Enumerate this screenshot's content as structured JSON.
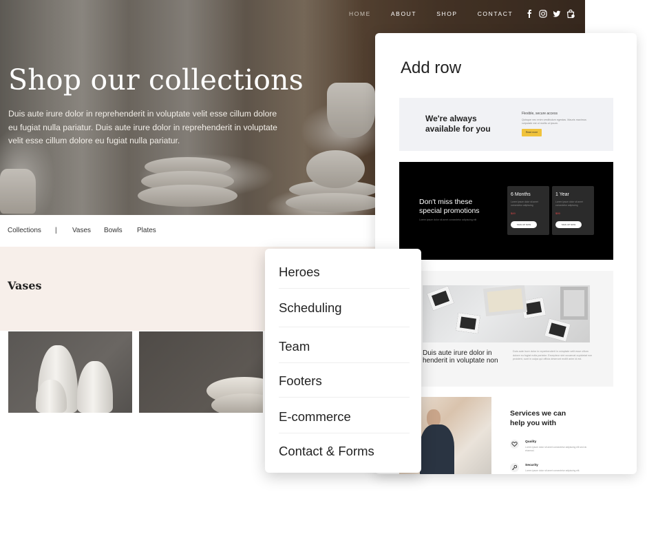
{
  "site": {
    "nav": [
      "HOME",
      "ABOUT",
      "SHOP",
      "CONTACT"
    ],
    "social_icons": [
      "facebook-icon",
      "instagram-icon",
      "twitter-icon"
    ],
    "cart_icon": "shopping-bag-icon",
    "hero": {
      "title": "Shop our collections",
      "body": "Duis aute irure dolor in reprehenderit in voluptate velit esse cillum dolore eu fugiat nulla pariatur. Duis aute irure dolor in reprehenderit in voluptate velit esse cillum dolore eu fugiat nulla pariatur."
    },
    "subnav": {
      "collections": "Collections",
      "separator": "|",
      "vases": "Vases",
      "bowls": "Bowls",
      "plates": "Plates"
    },
    "section_title": "Vases"
  },
  "panel": {
    "title": "Add row",
    "card1": {
      "headline_line1": "We're always",
      "headline_line2": "available for you",
      "small_heading": "Flexible, secure access",
      "small_text": "Quisque nec enim vestibulum egestas. Mauris maximus vulputate est ut mollis ut ipsum.",
      "button": "Read more",
      "accent": "#f0c33c"
    },
    "card2": {
      "headline_line1": "Don't miss these",
      "headline_line2": "special promotions",
      "small_text": "Lorem ipsum dolor sit amet consectetur adipiscing elit",
      "plans": [
        {
          "name": "6 Months",
          "text": "Lorem ipsum dolor sit amet consectetur adipiscing",
          "price": "$49",
          "button": "SIGN UP NOW"
        },
        {
          "name": "1 Year",
          "text": "Lorem ipsum dolor sit amet consectetur adipiscing",
          "price": "$99",
          "button": "SIGN UP NOW"
        }
      ],
      "price_color": "#e04848"
    },
    "card3": {
      "headline": "Duis aute irure dolor in henderit in voluptate non",
      "small_text": "Duis aute irure dolor in reprehenderit in voluptate velit esse cillum dolore eu fugiat nulla pariatur. Excepteur sint occaecat cupidatat non proident, sunt in culpa qui officia deserunt mollit anim id est."
    },
    "card4": {
      "headline_line1": "Services we can",
      "headline_line2": "help you with",
      "services": [
        {
          "name": "Quality",
          "icon": "heart-icon",
          "desc": "Lorem ipsum dolor sit amet consectetur adipiscing elit sed do eiusmod."
        },
        {
          "name": "Security",
          "icon": "key-icon",
          "desc": "Lorem ipsum dolor sit amet consectetur adipiscing elit."
        }
      ]
    }
  },
  "menu": {
    "items": [
      "Heroes",
      "Scheduling",
      "Team",
      "Footers",
      "E-commerce",
      "Contact & Forms"
    ]
  }
}
